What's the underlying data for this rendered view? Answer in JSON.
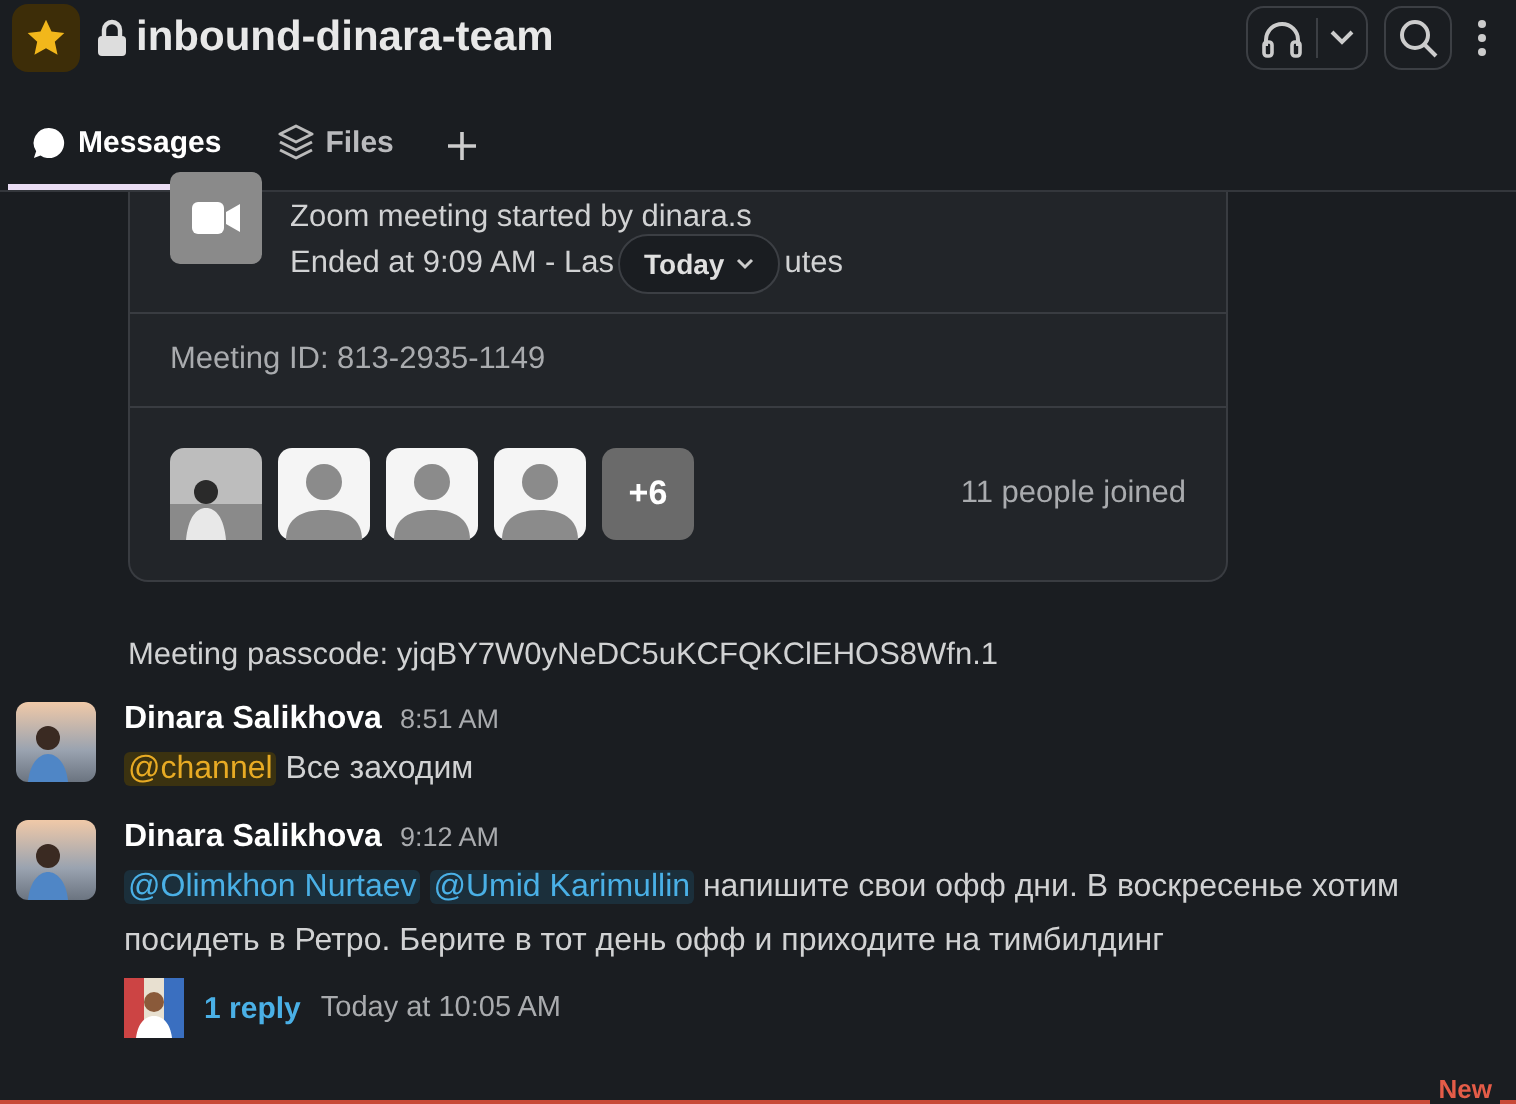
{
  "channel": {
    "name": "inbound-dinara-team",
    "starred": true,
    "locked": true
  },
  "tabs": [
    {
      "label": "Messages",
      "selected": true
    },
    {
      "label": "Files",
      "selected": false
    }
  ],
  "zoom_card": {
    "title": "Zoom meeting started by dinara.s",
    "status_before": "Ended at 9:09 AM - Las",
    "status_after": "utes",
    "meeting_id": "Meeting ID: 813-2935-1149",
    "participants": [
      {
        "kind": "photo"
      },
      {
        "kind": "default"
      },
      {
        "kind": "default"
      },
      {
        "kind": "default"
      }
    ],
    "more": "+6",
    "joined": "11 people joined"
  },
  "date_pill": "Today",
  "passcode": "Meeting passcode: yjqBY7W0yNeDC5uKCFQKClEHOS8Wfn.1",
  "messages": [
    {
      "author": "Dinara Salikhova",
      "time": "8:51 AM",
      "mentions": [
        {
          "text": "@channel",
          "kind": "channel"
        }
      ],
      "text": "Все заходим"
    },
    {
      "author": "Dinara Salikhova",
      "time": "9:12 AM",
      "mentions": [
        {
          "text": "@Olimkhon Nurtaev",
          "kind": "user"
        },
        {
          "text": "@Umid Karimullin",
          "kind": "user"
        }
      ],
      "text": "напишите свои офф дни. В воскресенье хотим посидеть в Ретро. Берите в тот день офф и приходите на тимбилдинг",
      "thread": {
        "replies": "1 reply",
        "last": "Today at 10:05 AM"
      }
    }
  ],
  "new_divider": "New"
}
